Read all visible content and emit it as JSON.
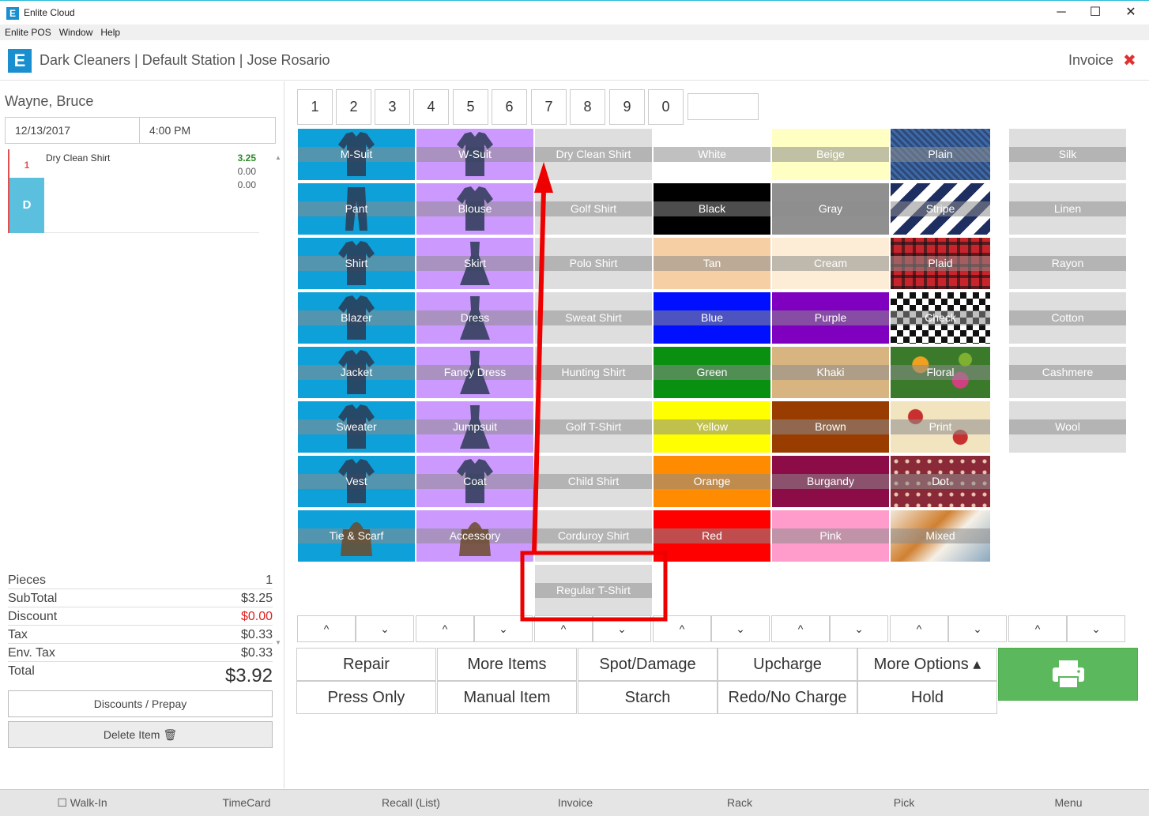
{
  "window": {
    "title": "Enlite Cloud",
    "icon": "E",
    "minimize": "─",
    "maximize": "☐",
    "close": "✕"
  },
  "menu": [
    "Enlite POS",
    "Window",
    "Help"
  ],
  "header": {
    "logo": "E",
    "title": "Dark Cleaners | Default Station | Jose Rosario",
    "invoice_label": "Invoice",
    "close_glyph": "✖"
  },
  "customer": {
    "name": "Wayne, Bruce",
    "date": "12/13/2017",
    "time": "4:00 PM"
  },
  "items": [
    {
      "qty": "1",
      "tag": "D",
      "name": "Dry Clean Shirt",
      "price": "3.25",
      "sub1": "0.00",
      "sub2": "0.00"
    }
  ],
  "scroll": {
    "up": "▲",
    "down": "▼"
  },
  "totals": {
    "pieces_label": "Pieces",
    "pieces": "1",
    "subtotal_label": "SubTotal",
    "subtotal": "$3.25",
    "discount_label": "Discount",
    "discount": "$0.00",
    "tax_label": "Tax",
    "tax": "$0.33",
    "envtax_label": "Env. Tax",
    "envtax": "$0.33",
    "total_label": "Total",
    "total": "$3.92"
  },
  "buttons": {
    "discounts": "Discounts / Prepay",
    "delete": "Delete Item 🗑"
  },
  "numpad": [
    "1",
    "2",
    "3",
    "4",
    "5",
    "6",
    "7",
    "8",
    "9",
    "0"
  ],
  "categories": {
    "col1": [
      "M-Suit",
      "Pant",
      "Shirt",
      "Blazer",
      "Jacket",
      "Sweater",
      "Vest",
      "Tie & Scarf"
    ],
    "col2": [
      "W-Suit",
      "Blouse",
      "Skirt",
      "Dress",
      "Fancy Dress",
      "Jumpsuit",
      "Coat",
      "Accessory"
    ]
  },
  "garments": [
    "Dry Clean Shirt",
    "Golf Shirt",
    "Polo Shirt",
    "Sweat Shirt",
    "Hunting Shirt",
    "Golf T-Shirt",
    "Child Shirt",
    "Corduroy Shirt",
    "Regular T-Shirt"
  ],
  "colors": {
    "col1": [
      {
        "name": "White",
        "color": "#ffffff"
      },
      {
        "name": "Black",
        "color": "#000000"
      },
      {
        "name": "Tan",
        "color": "#f6cfa4"
      },
      {
        "name": "Blue",
        "color": "#0010ff"
      },
      {
        "name": "Green",
        "color": "#0a9010"
      },
      {
        "name": "Yellow",
        "color": "#ffff00"
      },
      {
        "name": "Orange",
        "color": "#ff8c00"
      },
      {
        "name": "Red",
        "color": "#ff0000"
      }
    ],
    "col2": [
      {
        "name": "Beige",
        "color": "#ffffc4"
      },
      {
        "name": "Gray",
        "color": "#909090"
      },
      {
        "name": "Cream",
        "color": "#fdedd6"
      },
      {
        "name": "Purple",
        "color": "#8000c0"
      },
      {
        "name": "Khaki",
        "color": "#d8b480"
      },
      {
        "name": "Brown",
        "color": "#983c00"
      },
      {
        "name": "Burgandy",
        "color": "#8c0c48"
      },
      {
        "name": "Pink",
        "color": "#ff9ccc"
      }
    ]
  },
  "patterns": [
    "Plain",
    "Stripe",
    "Plaid",
    "Check",
    "Floral",
    "Print",
    "Dot",
    "Mixed"
  ],
  "fabrics": [
    "Silk",
    "Linen",
    "Rayon",
    "Cotton",
    "Cashmere",
    "Wool"
  ],
  "scroll_arrows": {
    "up": "^",
    "down": "⌄"
  },
  "actions": {
    "repair": "Repair",
    "more_items": "More Items",
    "spot": "Spot/Damage",
    "upcharge": "Upcharge",
    "more_options": "More Options ▴",
    "press_only": "Press Only",
    "manual": "Manual Item",
    "starch": "Starch",
    "redo": "Redo/No Charge",
    "hold": "Hold"
  },
  "bottom": [
    "☐ Walk-In",
    "TimeCard",
    "Recall (List)",
    "Invoice",
    "Rack",
    "Pick",
    "Menu"
  ],
  "accent": {
    "blue": "#0ea0d8",
    "violet": "#cc99ff",
    "green": "#5cb85c",
    "red_annotation": "#ee0000"
  }
}
